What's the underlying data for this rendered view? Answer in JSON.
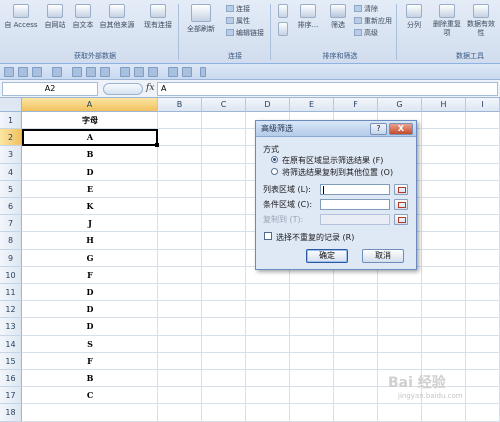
{
  "ribbon": {
    "buttons": [
      {
        "label": "自 Access"
      },
      {
        "label": "自网站"
      },
      {
        "label": "自文本"
      },
      {
        "label": "自其他来源"
      },
      {
        "label": "现有连接"
      },
      {
        "label": "全部刷新"
      },
      {
        "label": "排序..."
      },
      {
        "label": "筛选"
      },
      {
        "label": "分列"
      },
      {
        "label": "删除重复项"
      },
      {
        "label": "数据有效性"
      }
    ],
    "small_items": [
      "连接",
      "属性",
      "编辑链接",
      "清除",
      "重新应用",
      "高级"
    ],
    "groups": [
      "获取外部数据",
      "连接",
      "排序和筛选",
      "数据工具"
    ]
  },
  "formula_bar": {
    "name_box": "A2",
    "fx": "fx",
    "value": "A"
  },
  "sheet": {
    "columns": [
      "A",
      "B",
      "C",
      "D",
      "E",
      "F",
      "G",
      "H",
      "I"
    ],
    "rows": [
      "1",
      "2",
      "3",
      "4",
      "5",
      "6",
      "7",
      "8",
      "9",
      "10",
      "11",
      "12",
      "13",
      "14",
      "15",
      "16",
      "17",
      "18"
    ],
    "column_a": [
      "字母",
      "A",
      "B",
      "D",
      "E",
      "K",
      "J",
      "H",
      "G",
      "F",
      "D",
      "D",
      "D",
      "S",
      "F",
      "B",
      "C",
      ""
    ],
    "active_cell": "A2"
  },
  "dialog": {
    "title": "高级筛选",
    "help": "?",
    "close": "X",
    "section_label": "方式",
    "option_1": "在原有区域显示筛选结果 (F)",
    "option_2": "将筛选结果复制到其他位置 (O)",
    "list_range_label": "列表区域 (L):",
    "criteria_range_label": "条件区域 (C):",
    "copy_to_label": "复制到 (T):",
    "unique_checkbox": "选择不重复的记录 (R)",
    "ok": "确定",
    "cancel": "取消"
  },
  "watermark": {
    "logo": "Bai 经验",
    "url": "jingyan.baidu.com"
  }
}
